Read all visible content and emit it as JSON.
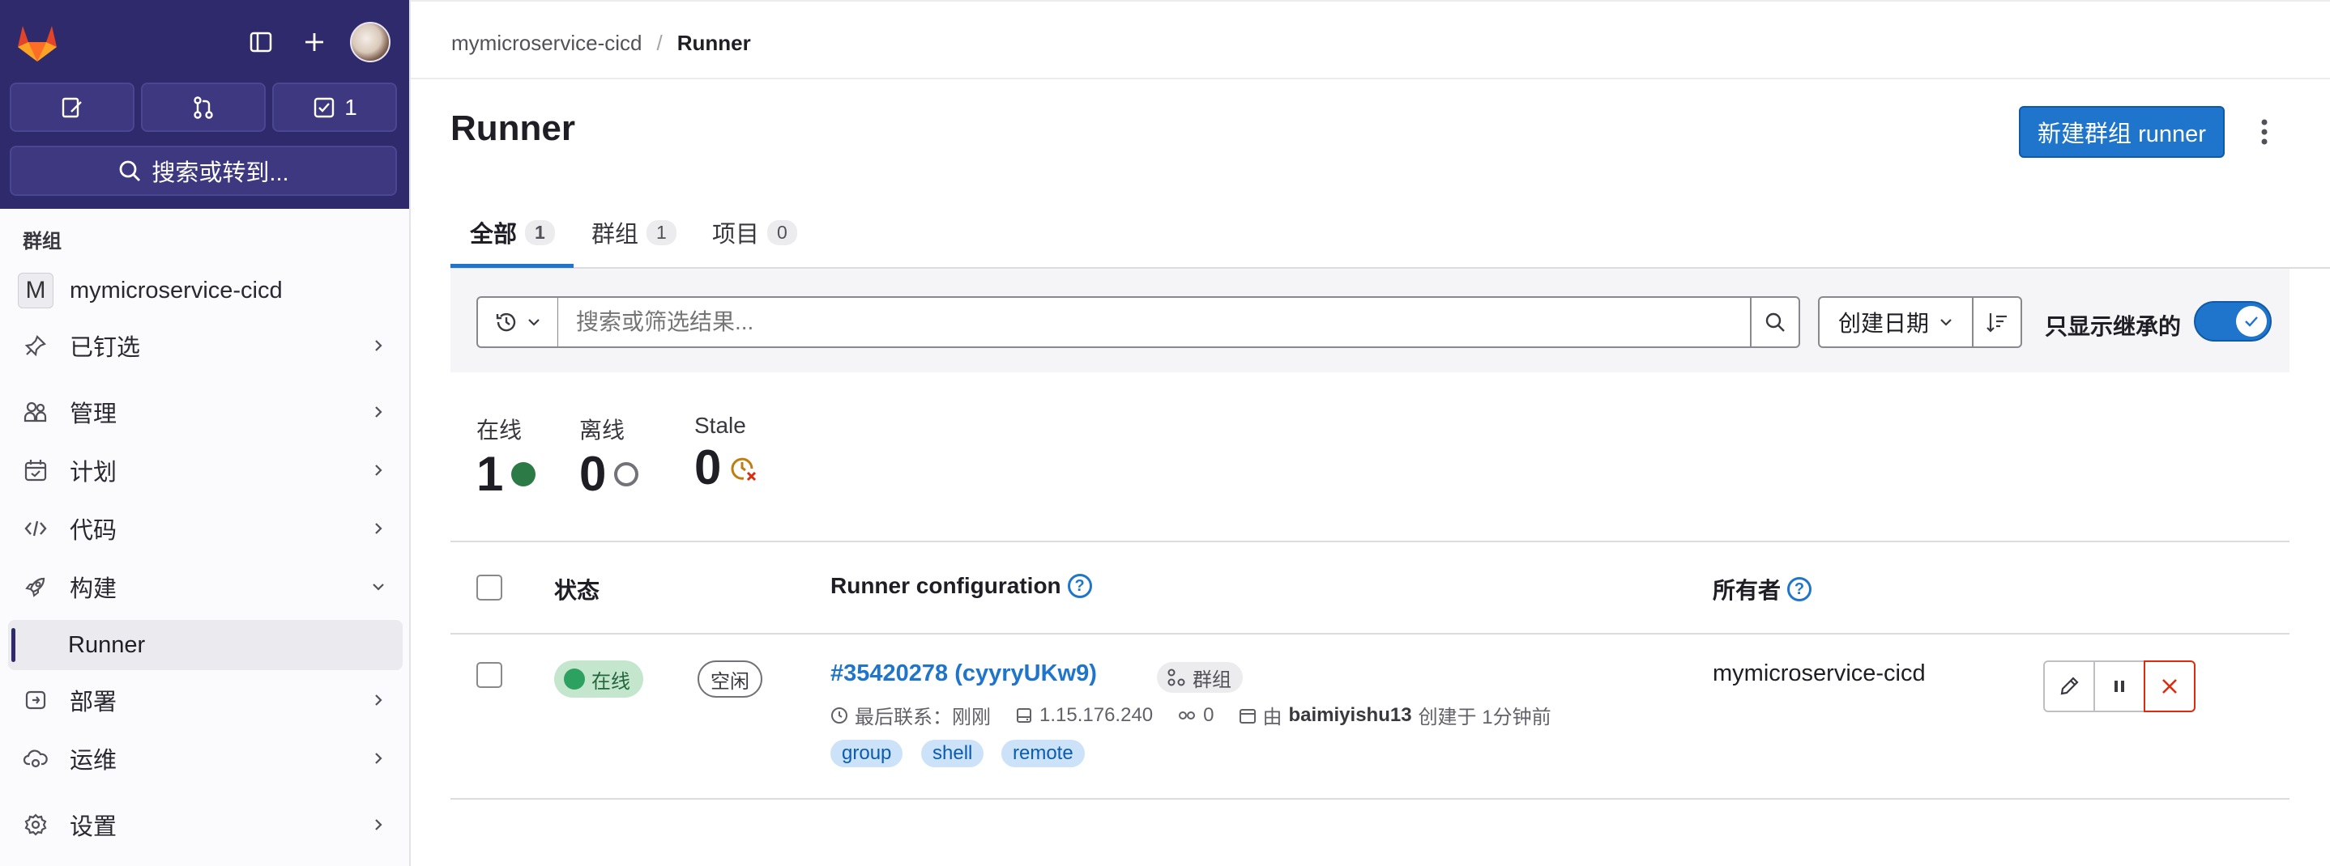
{
  "sidebar": {
    "quick": {
      "issues_label": "",
      "mr_label": "",
      "todos_count": "1"
    },
    "search_label": "搜索或转到...",
    "section_heading": "群组",
    "group": {
      "initial": "M",
      "name": "mymicroservice-cicd"
    },
    "items": [
      {
        "label": "已钉选",
        "icon": "pin-icon"
      },
      {
        "label": "管理",
        "icon": "users-icon"
      },
      {
        "label": "计划",
        "icon": "calendar-icon"
      },
      {
        "label": "代码",
        "icon": "code-icon"
      },
      {
        "label": "构建",
        "icon": "rocket-icon"
      },
      {
        "label": "部署",
        "icon": "deploy-icon"
      },
      {
        "label": "运维",
        "icon": "cloud-icon"
      },
      {
        "label": "设置",
        "icon": "gear-icon"
      }
    ],
    "active_sub": "Runner"
  },
  "breadcrumb": {
    "parent": "mymicroservice-cicd",
    "separator": "/",
    "current": "Runner"
  },
  "page": {
    "title": "Runner",
    "new_button": "新建群组 runner"
  },
  "tabs": [
    {
      "label": "全部",
      "count": "1"
    },
    {
      "label": "群组",
      "count": "1"
    },
    {
      "label": "项目",
      "count": "0"
    }
  ],
  "filter": {
    "placeholder": "搜索或筛选结果...",
    "sort_label": "创建日期",
    "toggle_label": "只显示继承的",
    "toggle_on": true
  },
  "stats": [
    {
      "label": "在线",
      "value": "1"
    },
    {
      "label": "离线",
      "value": "0"
    },
    {
      "label": "Stale",
      "value": "0"
    }
  ],
  "table": {
    "headers": {
      "status": "状态",
      "config": "Runner configuration",
      "owner": "所有者"
    },
    "rows": [
      {
        "status_online": "在线",
        "status_idle": "空闲",
        "runner_id": "#35420278 (cyyryUKw9)",
        "type_chip": "群组",
        "last_contact": "最后联系：刚刚",
        "ip": "1.15.176.240",
        "jobs": "0",
        "created_prefix": "由",
        "created_by": "baimiyishu13",
        "created_suffix": "创建于 1分钟前",
        "tags": [
          "group",
          "shell",
          "remote"
        ],
        "owner": "mymicroservice-cicd"
      }
    ]
  },
  "colors": {
    "brand_nav": "#2f2a6b",
    "primary": "#1f75cb",
    "online": "#2da160",
    "danger": "#dd2b0e",
    "stale": "#c17d10"
  }
}
